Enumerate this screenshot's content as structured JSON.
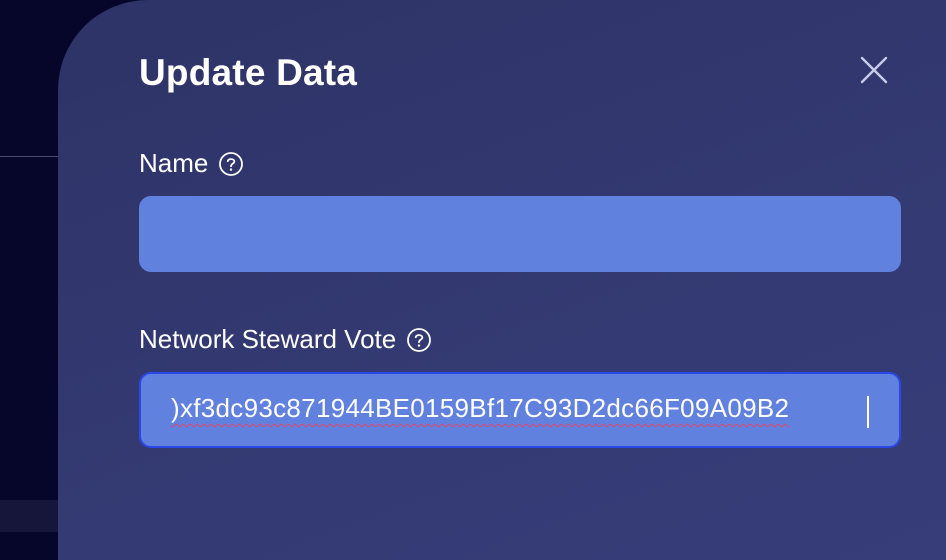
{
  "dialog": {
    "title": "Update Data",
    "close_icon": "close-icon"
  },
  "fields": {
    "name": {
      "label": "Name",
      "help_icon": "help-circle-icon",
      "value": ""
    },
    "steward_vote": {
      "label": "Network Steward Vote",
      "help_icon": "help-circle-icon",
      "value": ")xf3dc93c871944BE0159Bf17C93D2dc66F09A09B2"
    }
  },
  "colors": {
    "backdrop": "#05062a",
    "modal": "#2e3366",
    "input": "#6181df",
    "focus_border": "#2a48e8",
    "spellcheck_underline": "#e0466a"
  }
}
